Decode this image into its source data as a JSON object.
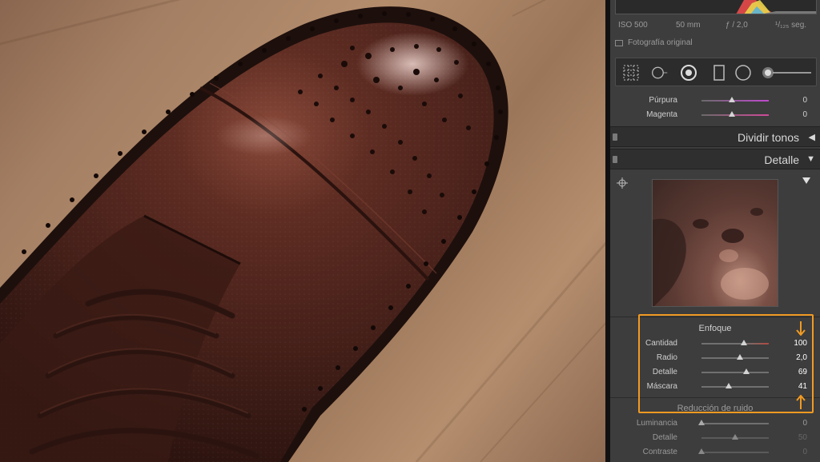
{
  "camera_info": {
    "iso": "ISO 500",
    "focal": "50 mm",
    "aperture": "ƒ / 2,0",
    "shutter": "¹/₁₂₅ seg."
  },
  "original_photo_label": "Fotografía original",
  "color_sliders": [
    {
      "label": "Púrpura",
      "value": "0",
      "level": 0.5
    },
    {
      "label": "Magenta",
      "value": "0",
      "level": 0.5
    }
  ],
  "sections": {
    "split_toning": "Dividir tonos",
    "detail": "Detalle"
  },
  "sharpening": {
    "title": "Enfoque",
    "sliders": [
      {
        "label": "Cantidad",
        "value": "100",
        "level": 0.67
      },
      {
        "label": "Radio",
        "value": "2,0",
        "level": 0.6
      },
      {
        "label": "Detalle",
        "value": "69",
        "level": 0.69
      },
      {
        "label": "Máscara",
        "value": "41",
        "level": 0.41
      }
    ]
  },
  "noise_reduction": {
    "title": "Reducción de ruido",
    "sliders": [
      {
        "label": "Luminancia",
        "value": "0",
        "level": 0.0
      },
      {
        "label": "Detalle",
        "value": "50",
        "level": 0.5
      },
      {
        "label": "Contraste",
        "value": "0",
        "level": 0.0
      }
    ]
  },
  "colors": {
    "highlight": "#f19a22",
    "panel_bg": "#3d3d3d"
  },
  "icons": [
    "grid-tool-icon",
    "spot-removal-icon",
    "red-eye-icon",
    "graduated-filter-icon",
    "radial-filter-icon",
    "brush-icon",
    "crosshair-icon",
    "collapse-triangle-icon"
  ]
}
